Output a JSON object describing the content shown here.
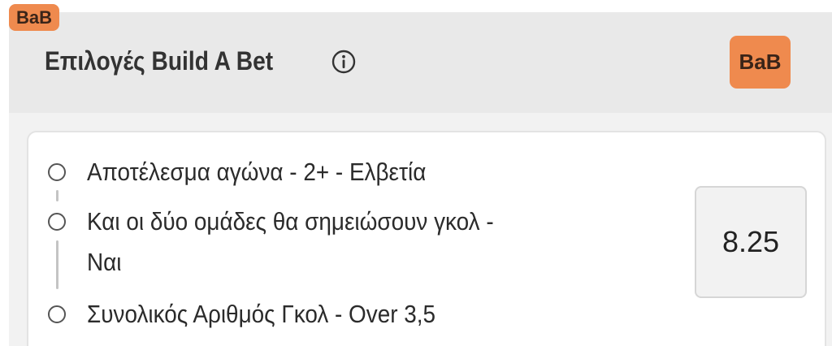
{
  "top_badge": {
    "label": "BaB"
  },
  "header": {
    "title": "Επιλογές Build A Bet",
    "info_icon": "info-circle-icon",
    "badge_label": "BaB"
  },
  "selections": [
    {
      "line1": "Αποτέλεσμα αγώνα - 2+ - Ελβετία",
      "line2": ""
    },
    {
      "line1": "Και οι δύο ομάδες θα σημειώσουν γκολ -",
      "line2": "Ναι"
    },
    {
      "line1": "Συνολικός Αριθμός Γκολ - Over 3,5",
      "line2": ""
    }
  ],
  "odds": {
    "value": "8.25"
  },
  "colors": {
    "accent": "#ef8a4e",
    "panel_bg": "#e9e9e9",
    "card_bg": "#ffffff",
    "connector": "#c4c4c4"
  }
}
